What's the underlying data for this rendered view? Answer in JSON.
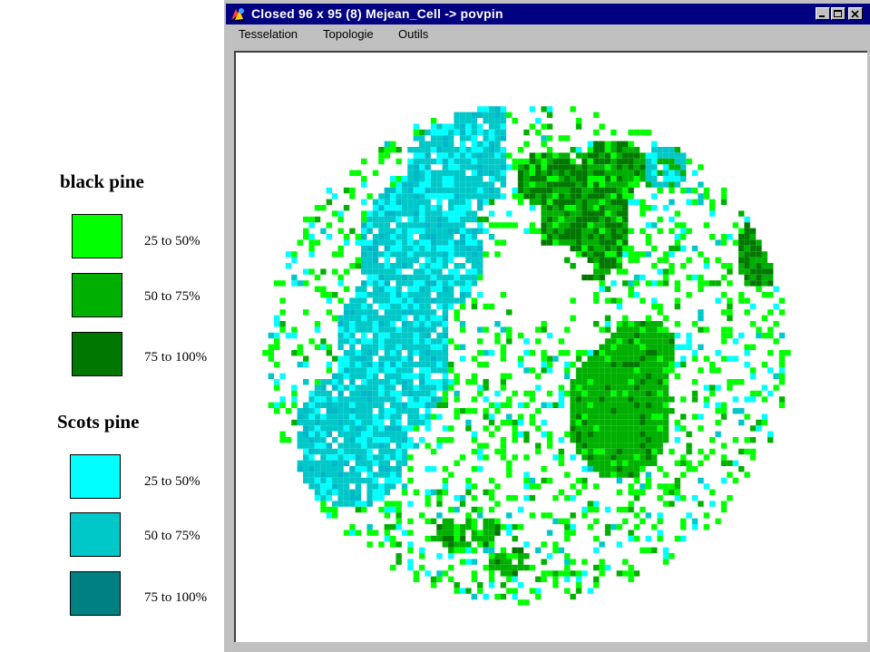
{
  "window": {
    "title": "Closed 96 x 95 (8)  Mejean_Cell -> povpin",
    "icon": "app-icon",
    "controls": [
      "minimize-icon",
      "maximize-icon",
      "close-icon"
    ]
  },
  "menu": {
    "items": [
      "Tesselation",
      "Topologie",
      "Outils"
    ]
  },
  "legend": {
    "groups": [
      {
        "title": "black pine",
        "items": [
          {
            "label": "25 to 50%",
            "color": "#00ff00"
          },
          {
            "label": "50 to 75%",
            "color": "#00b000"
          },
          {
            "label": "75 to 100%",
            "color": "#007800"
          }
        ]
      },
      {
        "title": "Scots pine",
        "items": [
          {
            "label": "25 to 50%",
            "color": "#00ffff"
          },
          {
            "label": "50 to 75%",
            "color": "#00c8c8"
          },
          {
            "label": "75 to 100%",
            "color": "#008080"
          }
        ]
      }
    ]
  },
  "map": {
    "grid": {
      "cols": 96,
      "rows": 95
    },
    "colors": {
      "bp25": "#00ff00",
      "bp50": "#00b000",
      "bp75": "#007800",
      "sp25": "#00ffff",
      "sp50": "#00c8c8",
      "sp75": "#008080"
    }
  }
}
